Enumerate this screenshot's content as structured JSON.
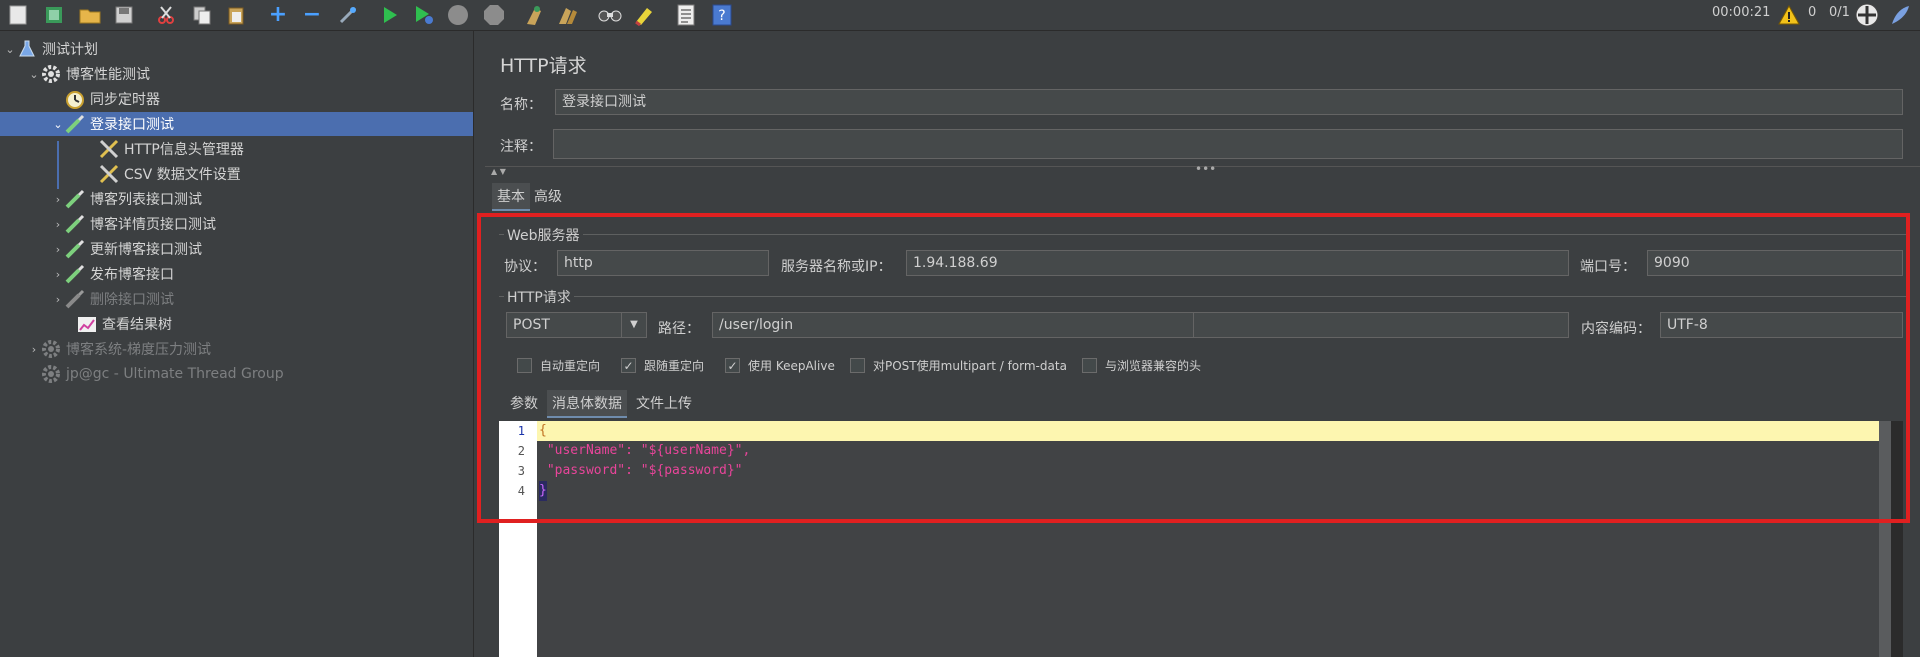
{
  "toolbar": {
    "icons": [
      "new-icon",
      "templates-icon",
      "open-icon",
      "save-icon",
      "cut-icon",
      "copy-icon",
      "paste-icon",
      "expand-icon",
      "collapse-icon",
      "toggle-icon",
      "start-icon",
      "start-no-pauses-icon",
      "stop-icon",
      "shutdown-icon",
      "clear-icon",
      "clear-all-icon",
      "search-icon",
      "reset-search-icon",
      "function-helper-icon",
      "help-icon"
    ],
    "elapsed": "00:00:21",
    "warnings": "0",
    "threads": "0/1"
  },
  "tree": {
    "items": [
      {
        "label": "测试计划",
        "icon": "flask-icon"
      },
      {
        "label": "博客性能测试",
        "icon": "gear-icon"
      },
      {
        "label": "同步定时器",
        "icon": "timer-icon"
      },
      {
        "label": "登录接口测试",
        "icon": "pipette-icon"
      },
      {
        "label": "HTTP信息头管理器",
        "icon": "tools-icon"
      },
      {
        "label": "CSV 数据文件设置",
        "icon": "tools-icon"
      },
      {
        "label": "博客列表接口测试",
        "icon": "pipette-icon"
      },
      {
        "label": "博客详情页接口测试",
        "icon": "pipette-icon"
      },
      {
        "label": "更新博客接口测试",
        "icon": "pipette-icon"
      },
      {
        "label": "发布博客接口",
        "icon": "pipette-icon"
      },
      {
        "label": "删除接口测试",
        "icon": "pipette-icon"
      },
      {
        "label": "查看结果树",
        "icon": "chart-icon"
      },
      {
        "label": "博客系统-梯度压力测试",
        "icon": "gear-icon"
      },
      {
        "label": "jp@gc - Ultimate Thread Group",
        "icon": "gear-icon"
      }
    ]
  },
  "panel": {
    "title": "HTTP请求",
    "name_label": "名称：",
    "name_value": "登录接口测试",
    "comment_label": "注释：",
    "comment_value": "",
    "tabs": [
      "基本",
      "高级"
    ],
    "web_server": {
      "title": "Web服务器",
      "protocol_label": "协议：",
      "protocol_value": "http",
      "server_label": "服务器名称或IP：",
      "server_value": "1.94.188.69",
      "port_label": "端口号：",
      "port_value": "9090"
    },
    "http_request": {
      "title": "HTTP请求",
      "method": "POST",
      "path_label": "路径：",
      "path_value": "/user/login",
      "encoding_label": "内容编码：",
      "encoding_value": "UTF-8"
    },
    "checkboxes": [
      {
        "label": "自动重定向",
        "checked": false
      },
      {
        "label": "跟随重定向",
        "checked": true
      },
      {
        "label": "使用 KeepAlive",
        "checked": true
      },
      {
        "label": "对POST使用multipart / form-data",
        "checked": false
      },
      {
        "label": "与浏览器兼容的头",
        "checked": false
      }
    ],
    "sub_tabs": [
      "参数",
      "消息体数据",
      "文件上传"
    ],
    "code_lines": [
      {
        "num": "1",
        "text": "{"
      },
      {
        "num": "2",
        "text": " \"userName\": \"${userName}\","
      },
      {
        "num": "3",
        "text": " \"password\": \"${password}\""
      },
      {
        "num": "4",
        "text": "}"
      }
    ]
  },
  "colors": {
    "selection": "#4b6eaf",
    "highlight_box": "#e02020",
    "code_key": "#e8459a"
  }
}
